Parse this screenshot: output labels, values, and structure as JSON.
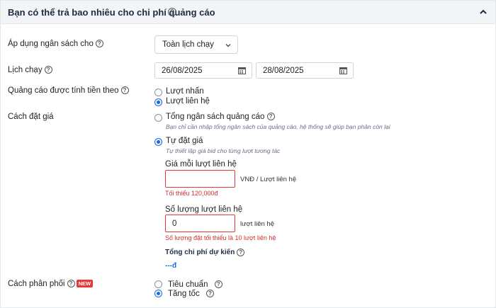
{
  "header": {
    "title": "Bạn có thể trả bao nhiêu cho chi phí quảng cáo"
  },
  "budget_scope": {
    "label": "Áp dụng ngân sách cho",
    "selected": "Toàn lịch chạy"
  },
  "schedule": {
    "label": "Lịch chạy",
    "start": "26/08/2025",
    "end": "28/08/2025"
  },
  "billing": {
    "label": "Quảng cáo được tính tiền theo",
    "options": [
      {
        "label": "Lượt nhấn",
        "selected": false
      },
      {
        "label": "Lượt liên hệ",
        "selected": true
      }
    ]
  },
  "bidding": {
    "label": "Cách đặt giá",
    "total_budget": {
      "label": "Tổng ngân sách quảng cáo",
      "hint": "Bạn chỉ cần nhập tổng ngân sách của quảng cáo, hệ thống sẽ giúp bạn phân còn lại",
      "selected": false
    },
    "self_bid": {
      "label": "Tự đặt giá",
      "hint": "Tự thiết lập giá bid cho từng lượt tương tác",
      "selected": true
    },
    "price_field": {
      "label": "Giá mỗi lượt liên hệ",
      "value": "",
      "unit": "VNĐ / Lượt liên hệ",
      "error": "Tối thiểu 120,000đ"
    },
    "count_field": {
      "label": "Số lượng lượt liên hệ",
      "value": "0",
      "unit": "lượt liên hệ",
      "error": "Số lượng đặt tối thiểu là 10 lượt liên hệ"
    },
    "estimate": {
      "label": "Tổng chi phí dự kiến",
      "value": "---đ"
    }
  },
  "distribution": {
    "label": "Cách phân phối",
    "badge": "NEW",
    "options": [
      {
        "label": "Tiêu chuẩn",
        "selected": false
      },
      {
        "label": "Tăng tốc",
        "selected": true
      }
    ]
  },
  "colors": {
    "accent": "#1769e0",
    "error": "#e53935",
    "header_bg": "#f2f4f7"
  },
  "icons": [
    "help-icon",
    "chevron-up-icon",
    "chevron-down-icon",
    "calendar-icon"
  ]
}
